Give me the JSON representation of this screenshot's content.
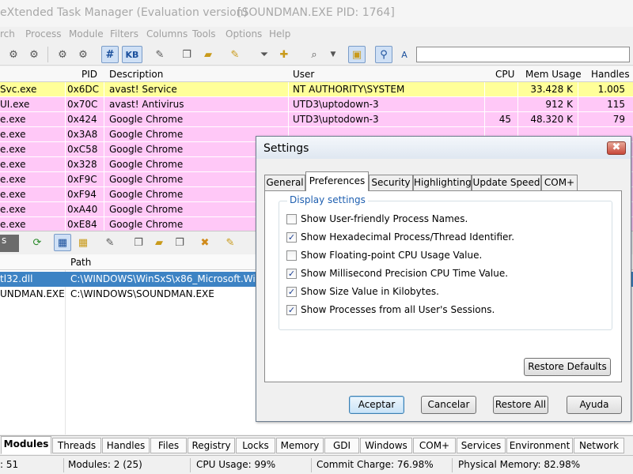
{
  "window": {
    "app_title": "eXtended Task Manager (Evaluation version)",
    "process_title": "[SOUNDMAN.EXE    PID: 1764]"
  },
  "menu": [
    "rch",
    "Process",
    "Module",
    "Filters",
    "Columns",
    "Tools",
    "Options",
    "Help"
  ],
  "toolbar": {
    "hash_label": "#",
    "kb_label": "KB",
    "search_value": ""
  },
  "process_table": {
    "headers": {
      "pid": "PID",
      "description": "Description",
      "user": "User",
      "cpu": "CPU",
      "mem": "Mem Usage",
      "handles": "Handles"
    },
    "rows": [
      {
        "name": "Svc.exe",
        "pid": "0x6DC",
        "description": "avast! Service",
        "user": "NT AUTHORITY\\SYSTEM",
        "cpu": "",
        "mem": "33.428 K",
        "handles": "1.005",
        "color": "#ffff99"
      },
      {
        "name": "UI.exe",
        "pid": "0x70C",
        "description": "avast! Antivirus",
        "user": "UTD3\\uptodown-3",
        "cpu": "",
        "mem": "912 K",
        "handles": "115",
        "color": "#ffc8f7"
      },
      {
        "name": "e.exe",
        "pid": "0x424",
        "description": "Google Chrome",
        "user": "UTD3\\uptodown-3",
        "cpu": "45",
        "mem": "48.320 K",
        "handles": "79",
        "color": "#ffc8f7"
      },
      {
        "name": "e.exe",
        "pid": "0x3A8",
        "description": "Google Chrome",
        "user": "",
        "cpu": "",
        "mem": "",
        "handles": "",
        "color": "#ffc8f7"
      },
      {
        "name": "e.exe",
        "pid": "0xC58",
        "description": "Google Chrome",
        "user": "",
        "cpu": "",
        "mem": "",
        "handles": "",
        "color": "#ffc8f7"
      },
      {
        "name": "e.exe",
        "pid": "0x328",
        "description": "Google Chrome",
        "user": "",
        "cpu": "",
        "mem": "",
        "handles": "",
        "color": "#ffc8f7"
      },
      {
        "name": "e.exe",
        "pid": "0xF9C",
        "description": "Google Chrome",
        "user": "",
        "cpu": "",
        "mem": "",
        "handles": "",
        "color": "#ffc8f7"
      },
      {
        "name": "e.exe",
        "pid": "0xF94",
        "description": "Google Chrome",
        "user": "",
        "cpu": "",
        "mem": "",
        "handles": "",
        "color": "#ffc8f7"
      },
      {
        "name": "e.exe",
        "pid": "0xA40",
        "description": "Google Chrome",
        "user": "",
        "cpu": "",
        "mem": "",
        "handles": "",
        "color": "#ffc8f7"
      },
      {
        "name": "e.exe",
        "pid": "0xE84",
        "description": "Google Chrome",
        "user": "",
        "cpu": "",
        "mem": "",
        "handles": "",
        "color": "#ffc8f7"
      }
    ]
  },
  "lower_pane": {
    "tab_fragment": "s",
    "headers": {
      "path": "Path"
    },
    "rows": [
      {
        "name": "tl32.dll",
        "path": "C:\\WINDOWS\\WinSxS\\x86_Microsoft.Windo"
      },
      {
        "name": "UNDMAN.EXE",
        "path": "C:\\WINDOWS\\SOUNDMAN.EXE"
      }
    ]
  },
  "bottom_tabs": [
    "Modules",
    "Threads",
    "Handles",
    "Files",
    "Registry",
    "Locks",
    "Memory",
    "GDI",
    "Windows",
    "COM+",
    "Services",
    "Environment",
    "Network"
  ],
  "status": {
    "processes": ": 51",
    "modules": "Modules: 2 (25)",
    "cpu": "CPU Usage: 99%",
    "commit": "Commit Charge: 76.98%",
    "physical": "Physical Memory: 82.98%"
  },
  "dialog": {
    "title": "Settings",
    "close_icon": "✖",
    "tabs": [
      "General",
      "Preferences",
      "Security",
      "Highlighting",
      "Update Speed",
      "COM+"
    ],
    "active_tab": "Preferences",
    "group_title": "Display settings",
    "options": [
      {
        "label": "Show User-friendly Process Names.",
        "checked": false
      },
      {
        "label": "Show Hexadecimal Process/Thread Identifier.",
        "checked": true
      },
      {
        "label": "Show Floating-point CPU Usage Value.",
        "checked": false
      },
      {
        "label": "Show Millisecond Precision CPU Time Value.",
        "checked": true
      },
      {
        "label": "Show Size Value in Kilobytes.",
        "checked": true
      },
      {
        "label": "Show Processes from all User's Sessions.",
        "checked": true
      }
    ],
    "restore_defaults_label": "Restore Defaults",
    "accept_label": "Aceptar",
    "cancel_label": "Cancelar",
    "restore_all_label": "Restore All",
    "help_label": "Ayuda"
  }
}
